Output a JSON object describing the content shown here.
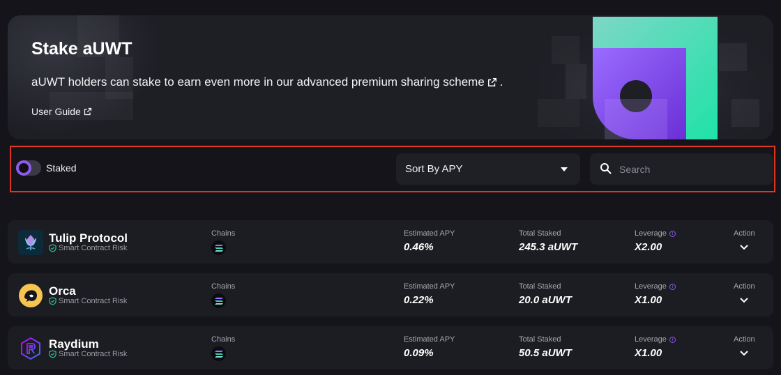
{
  "hero": {
    "title": "Stake aUWT",
    "description": "aUWT holders can stake to earn even more in our advanced premium sharing scheme",
    "description_suffix": ".",
    "user_guide": "User Guide"
  },
  "filters": {
    "staked_toggle_label": "Staked",
    "staked_toggle_on": false,
    "sort_label": "Sort By APY",
    "search_placeholder": "Search"
  },
  "columns": {
    "chains": "Chains",
    "apy": "Estimated APY",
    "total_staked": "Total Staked",
    "leverage": "Leverage",
    "action": "Action"
  },
  "pools": [
    {
      "name": "Tulip Protocol",
      "risk": "Smart Contract Risk",
      "chain_icon": "solana-icon",
      "apy": "0.46%",
      "total_staked": "245.3 aUWT",
      "leverage": "X2.00"
    },
    {
      "name": "Orca",
      "risk": "Smart Contract Risk",
      "chain_icon": "solana-icon",
      "apy": "0.22%",
      "total_staked": "20.0 aUWT",
      "leverage": "X1.00"
    },
    {
      "name": "Raydium",
      "risk": "Smart Contract Risk",
      "chain_icon": "solana-icon",
      "apy": "0.09%",
      "total_staked": "50.5 aUWT",
      "leverage": "X1.00"
    }
  ],
  "colors": {
    "accent": "#8d5bea",
    "highlight_border": "#e0361f",
    "background": "#14141a",
    "card": "#1c1d22",
    "shield": "#2fb58a"
  }
}
